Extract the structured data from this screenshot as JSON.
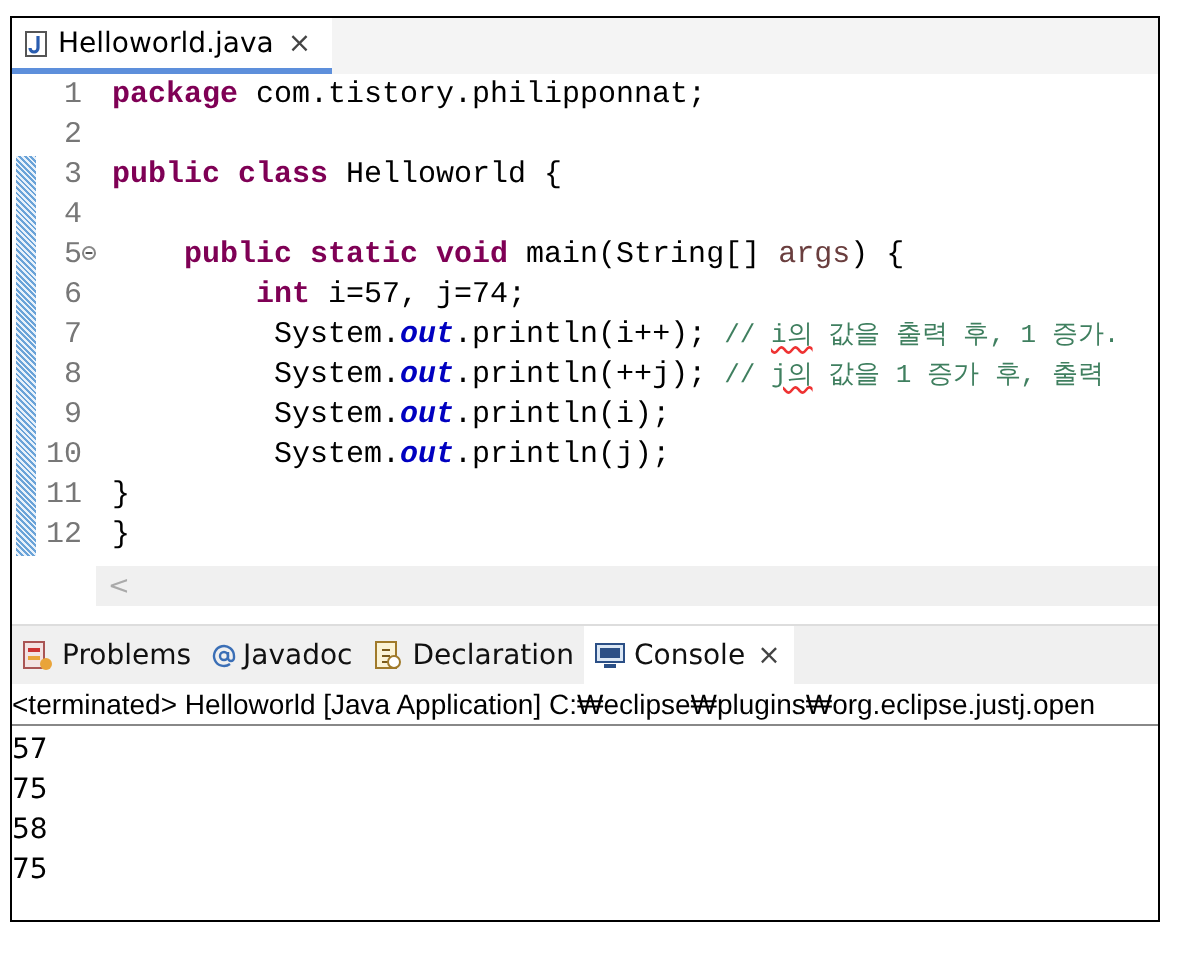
{
  "editor": {
    "tabs": [
      {
        "label": "Helloworld.java",
        "close": "×",
        "selected": true
      }
    ],
    "lines": [
      {
        "number": "1",
        "tokens": [
          {
            "kind": "keyword",
            "text": "package"
          },
          {
            "kind": "plain",
            "text": " com.tistory.philipponnat;"
          }
        ]
      },
      {
        "number": "2"
      },
      {
        "number": "3",
        "tokens": [
          {
            "kind": "keyword",
            "text": "public class"
          },
          {
            "kind": "plain",
            "text": " Helloworld {"
          }
        ]
      },
      {
        "number": "4"
      },
      {
        "number": "5",
        "fold_expanded": true,
        "tokens": [
          {
            "kind": "keyword",
            "text": "    public static void"
          },
          {
            "kind": "plain",
            "text": " main(String[] "
          },
          {
            "kind": "param",
            "text": "args"
          },
          {
            "kind": "plain",
            "text": ") {"
          }
        ]
      },
      {
        "number": "6",
        "tokens": [
          {
            "kind": "keyword",
            "text": "        int"
          },
          {
            "kind": "plain",
            "text": " i=57, j=74;"
          }
        ]
      },
      {
        "number": "7",
        "tokens": [
          {
            "kind": "plain",
            "text": "         System."
          },
          {
            "kind": "field",
            "text": "out"
          },
          {
            "kind": "plain",
            "text": ".println(i++); "
          },
          {
            "kind": "comment",
            "text": "// "
          },
          {
            "kind": "comment_flagged",
            "text": "i의"
          },
          {
            "kind": "comment",
            "text": " 값을 출력 후, 1 증가."
          }
        ]
      },
      {
        "number": "8",
        "tokens": [
          {
            "kind": "plain",
            "text": "         System."
          },
          {
            "kind": "field",
            "text": "out"
          },
          {
            "kind": "plain",
            "text": ".println(++j); "
          },
          {
            "kind": "comment",
            "text": "// "
          },
          {
            "kind": "comment_flagged",
            "text": "j의"
          },
          {
            "kind": "comment",
            "text": " 값을 1 증가 후, 출력"
          }
        ]
      },
      {
        "number": "9",
        "tokens": [
          {
            "kind": "plain",
            "text": "         System."
          },
          {
            "kind": "field",
            "text": "out"
          },
          {
            "kind": "plain",
            "text": ".println(i);"
          }
        ]
      },
      {
        "number": "10",
        "tokens": [
          {
            "kind": "plain",
            "text": "         System."
          },
          {
            "kind": "field",
            "text": "out"
          },
          {
            "kind": "plain",
            "text": ".println(j);"
          }
        ]
      },
      {
        "number": "11",
        "tokens": [
          {
            "kind": "plain",
            "text": "}"
          }
        ]
      },
      {
        "number": "12",
        "tokens": [
          {
            "kind": "plain",
            "text": "}"
          }
        ]
      }
    ],
    "scroll_arrow": "<"
  },
  "panel": {
    "tabs": [
      {
        "kind": "problems",
        "label": "Problems",
        "selected": false
      },
      {
        "kind": "javadoc",
        "label": "Javadoc",
        "selected": false
      },
      {
        "kind": "declaration",
        "label": "Declaration",
        "selected": false
      },
      {
        "kind": "console",
        "label": "Console",
        "close": "×",
        "selected": true
      }
    ],
    "header": "<terminated> Helloworld [Java Application] C:₩eclipse₩plugins₩org.eclipse.justj.open",
    "output": [
      "57",
      "75",
      "58",
      "75"
    ]
  }
}
